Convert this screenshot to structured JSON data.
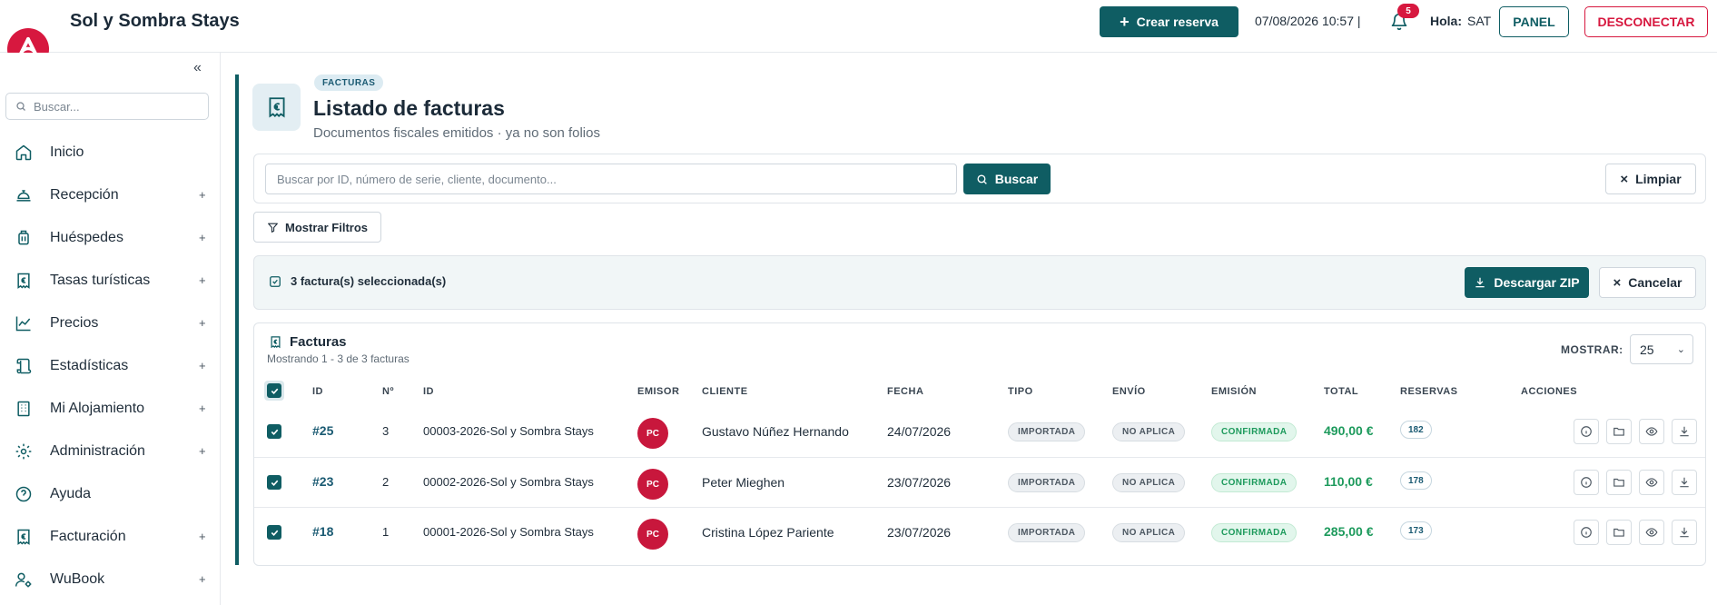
{
  "app": {
    "brand": "Sol y Sombra Stays",
    "create_label": "Crear reserva",
    "datetime": "07/08/2026 10:57 |",
    "notifications_count": "5",
    "hola_label": "Hola:",
    "user": "SAT",
    "panel_label": "PANEL",
    "logout_label": "DESCONECTAR",
    "accent": "#0f5d63",
    "brand_red": "#d7183f"
  },
  "sidebar": {
    "search_placeholder": "Buscar...",
    "items": [
      {
        "label": "Inicio",
        "icon": "home-icon",
        "expandable": false
      },
      {
        "label": "Recepción",
        "icon": "bell-desk-icon",
        "expandable": true
      },
      {
        "label": "Huéspedes",
        "icon": "luggage-icon",
        "expandable": true
      },
      {
        "label": "Tasas turísticas",
        "icon": "euro-receipt-icon",
        "expandable": true
      },
      {
        "label": "Precios",
        "icon": "line-chart-icon",
        "expandable": true
      },
      {
        "label": "Estadísticas",
        "icon": "scroll-icon",
        "expandable": true
      },
      {
        "label": "Mi Alojamiento",
        "icon": "building-icon",
        "expandable": true
      },
      {
        "label": "Administración",
        "icon": "gear-icon",
        "expandable": true
      },
      {
        "label": "Ayuda",
        "icon": "help-icon",
        "expandable": false
      },
      {
        "label": "Facturación",
        "icon": "euro-receipt-icon",
        "expandable": true
      },
      {
        "label": "WuBook",
        "icon": "user-gear-icon",
        "expandable": true
      }
    ],
    "plus": "+"
  },
  "header": {
    "badge": "FACTURAS",
    "title": "Listado de facturas",
    "subtitle": "Documentos fiscales emitidos · ya no son folios"
  },
  "search": {
    "placeholder": "Buscar por ID, número de serie, cliente, documento...",
    "button": "Buscar",
    "clear": "Limpiar"
  },
  "filters": {
    "button": "Mostrar Filtros"
  },
  "selection": {
    "text": "3 factura(s) seleccionada(s)",
    "zip": "Descargar ZIP",
    "cancel": "Cancelar"
  },
  "table": {
    "title": "Facturas",
    "subtitle": "Mostrando 1 - 3 de 3 facturas",
    "show_label": "MOSTRAR:",
    "show_value": "25",
    "columns": [
      "ID",
      "Nº",
      "ID",
      "EMISOR",
      "CLIENTE",
      "FECHA",
      "TIPO",
      "ENVÍO",
      "EMISIÓN",
      "TOTAL",
      "RESERVAS",
      "ACCIONES"
    ],
    "rows": [
      {
        "id": "#25",
        "num": "3",
        "serie": "00003-2026-Sol y Sombra Stays",
        "emisor": "PC",
        "cliente": "Gustavo Núñez Hernando",
        "fecha": "24/07/2026",
        "tipo": "IMPORTADA",
        "envio": "NO APLICA",
        "emision": "CONFIRMADA",
        "total": "490,00 €",
        "reservas": "182"
      },
      {
        "id": "#23",
        "num": "2",
        "serie": "00002-2026-Sol y Sombra Stays",
        "emisor": "PC",
        "cliente": "Peter Mieghen",
        "fecha": "23/07/2026",
        "tipo": "IMPORTADA",
        "envio": "NO APLICA",
        "emision": "CONFIRMADA",
        "total": "110,00 €",
        "reservas": "178"
      },
      {
        "id": "#18",
        "num": "1",
        "serie": "00001-2026-Sol y Sombra Stays",
        "emisor": "PC",
        "cliente": "Cristina López Pariente",
        "fecha": "23/07/2026",
        "tipo": "IMPORTADA",
        "envio": "NO APLICA",
        "emision": "CONFIRMADA",
        "total": "285,00 €",
        "reservas": "173"
      }
    ]
  }
}
